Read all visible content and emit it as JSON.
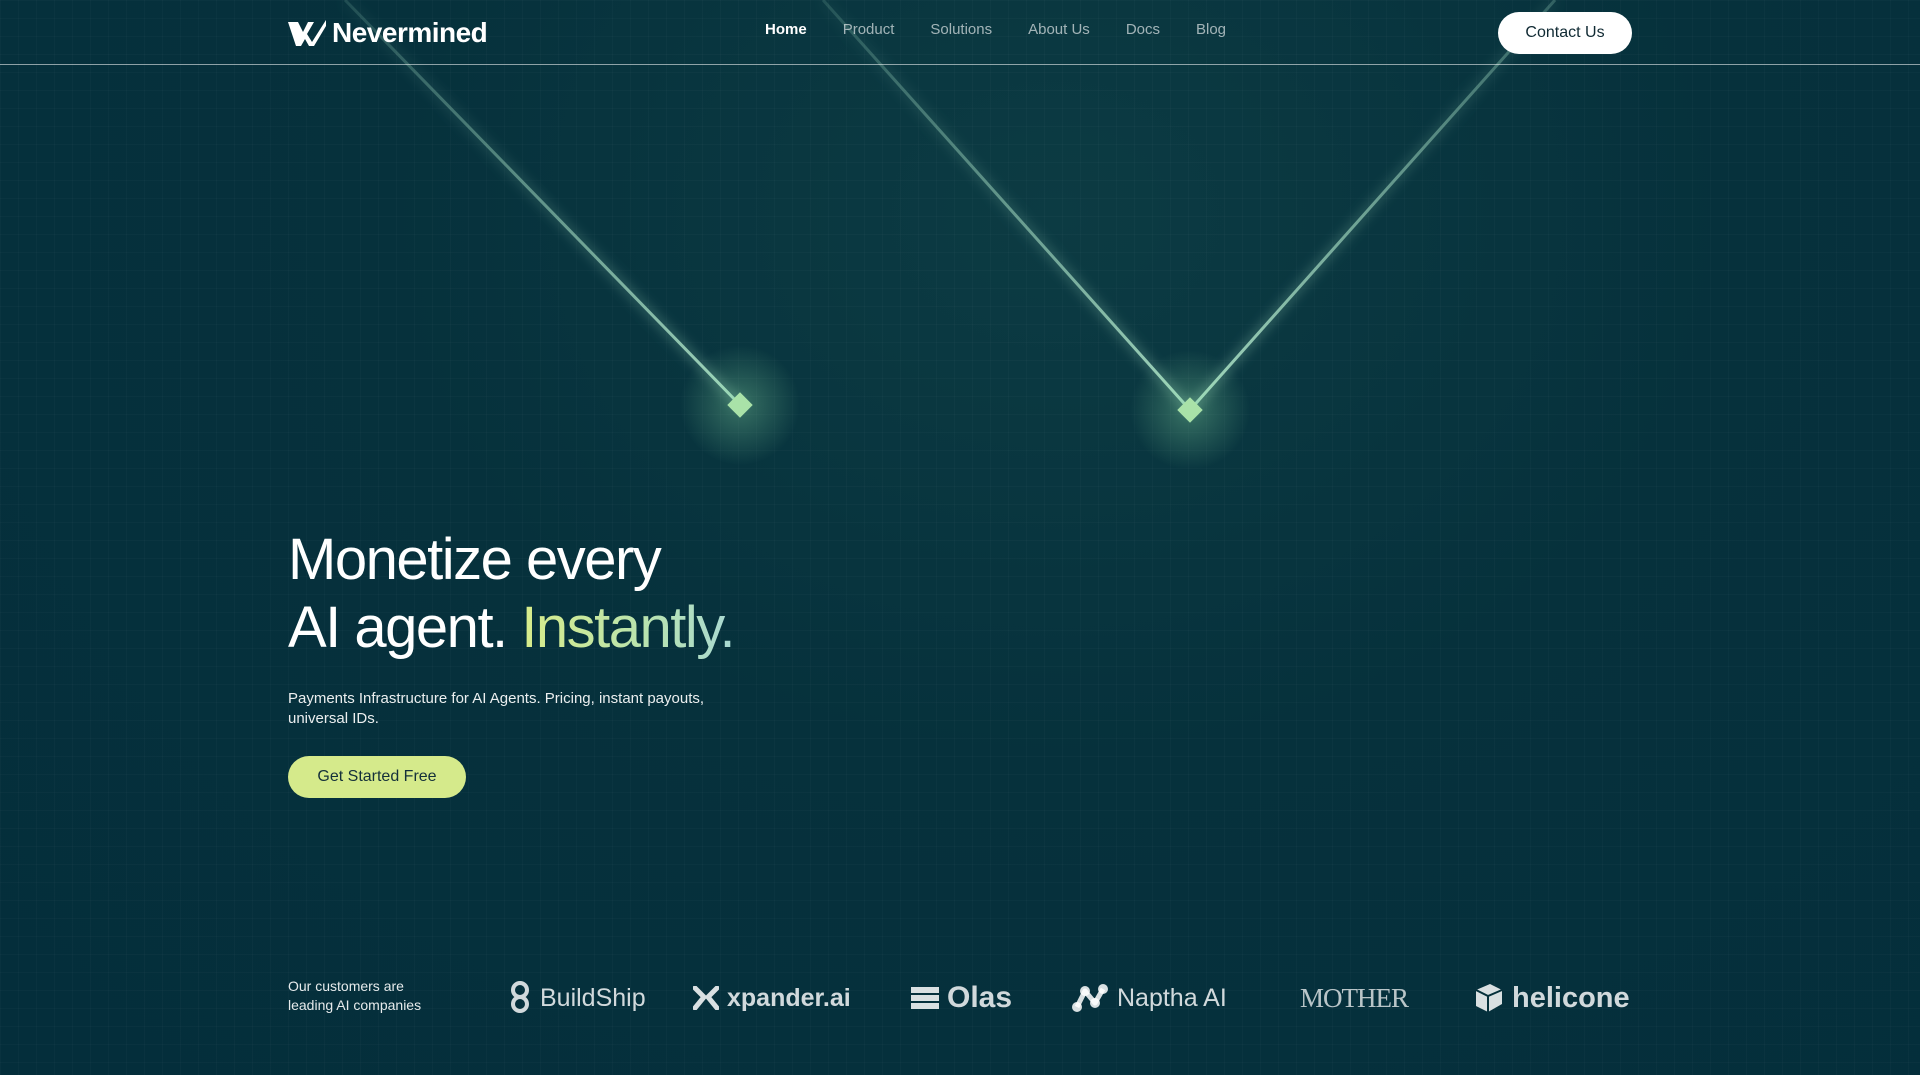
{
  "brand": {
    "name": "Nevermined",
    "logo_icon": "nevermined-logo-icon"
  },
  "nav": {
    "items": [
      {
        "label": "Home",
        "active": true
      },
      {
        "label": "Product",
        "active": false
      },
      {
        "label": "Solutions",
        "active": false
      },
      {
        "label": "About Us",
        "active": false
      },
      {
        "label": "Docs",
        "active": false
      },
      {
        "label": "Blog",
        "active": false
      }
    ],
    "contact_label": "Contact Us"
  },
  "hero": {
    "title_line1": "Monetize every",
    "title_line2": "AI agent.",
    "title_accent": "Instantly.",
    "subtitle": "Payments Infrastructure for AI Agents. Pricing, instant payouts, universal IDs.",
    "cta_label": "Get Started Free"
  },
  "customers": {
    "label": "Our customers are leading AI companies",
    "logos": [
      {
        "name": "BuildShip",
        "icon": "buildship-logo-icon"
      },
      {
        "name": "xpander.ai",
        "icon": "xpander-logo-icon"
      },
      {
        "name": "Olas",
        "icon": "olas-logo-icon"
      },
      {
        "name": "Naptha AI",
        "icon": "naptha-logo-icon"
      },
      {
        "name": "MOTHER",
        "icon": "mother-logo-icon"
      },
      {
        "name": "helicone",
        "icon": "helicone-logo-icon"
      }
    ]
  },
  "colors": {
    "background": "#05303b",
    "accent_green": "#d5ea8b",
    "beam": "#9fd9c0",
    "text": "#ffffff"
  }
}
